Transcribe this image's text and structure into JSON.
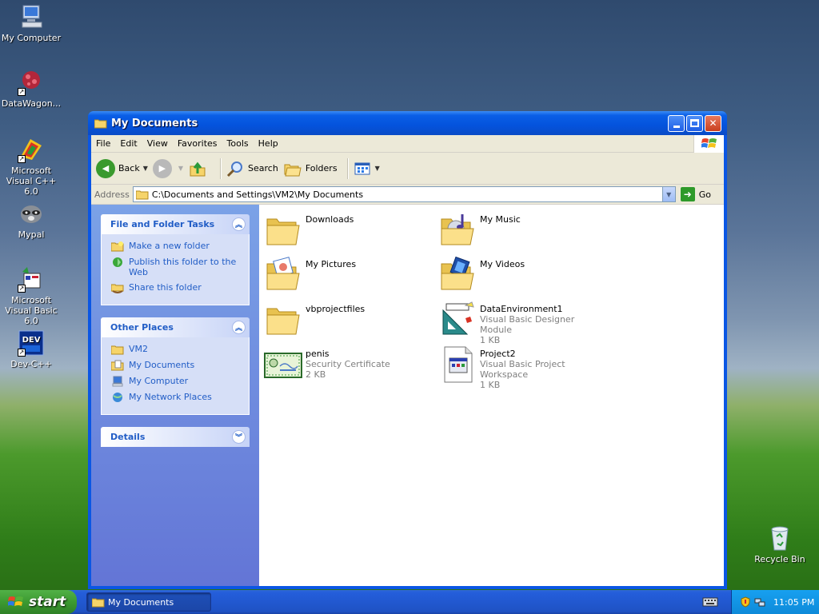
{
  "desktop": {
    "icons": [
      {
        "label": "My Computer"
      },
      {
        "label": "DataWagon..."
      },
      {
        "label": "Microsoft Visual C++ 6.0"
      },
      {
        "label": "Mypal"
      },
      {
        "label": "Microsoft Visual Basic 6.0"
      },
      {
        "label": "Dev-C++"
      },
      {
        "label": "Recycle Bin"
      }
    ]
  },
  "window": {
    "title": "My Documents",
    "menu": [
      "File",
      "Edit",
      "View",
      "Favorites",
      "Tools",
      "Help"
    ],
    "toolbar": {
      "back": "Back",
      "search": "Search",
      "folders": "Folders"
    },
    "address": {
      "label": "Address",
      "value": "C:\\Documents and Settings\\VM2\\My Documents",
      "go": "Go"
    },
    "taskpane": {
      "file_tasks": {
        "title": "File and Folder Tasks",
        "items": [
          "Make a new folder",
          "Publish this folder to the Web",
          "Share this folder"
        ]
      },
      "other_places": {
        "title": "Other Places",
        "items": [
          "VM2",
          "My Documents",
          "My Computer",
          "My Network Places"
        ]
      },
      "details": {
        "title": "Details"
      }
    },
    "files": [
      {
        "name": "Downloads",
        "type": "",
        "size": "",
        "icon": "folder-icon"
      },
      {
        "name": "My Music",
        "type": "",
        "size": "",
        "icon": "music-folder-icon"
      },
      {
        "name": "My Pictures",
        "type": "",
        "size": "",
        "icon": "pictures-folder-icon"
      },
      {
        "name": "My Videos",
        "type": "",
        "size": "",
        "icon": "videos-folder-icon"
      },
      {
        "name": "vbprojectfiles",
        "type": "",
        "size": "",
        "icon": "folder-icon"
      },
      {
        "name": "DataEnvironment1",
        "type": "Visual Basic Designer Module",
        "size": "1 KB",
        "icon": "vb-designer-icon"
      },
      {
        "name": "penis",
        "type": "Security Certificate",
        "size": "2 KB",
        "icon": "certificate-icon"
      },
      {
        "name": "Project2",
        "type": "Visual Basic Project Workspace",
        "size": "1 KB",
        "icon": "vb-project-icon"
      }
    ]
  },
  "taskbar": {
    "start": "start",
    "item": "My Documents",
    "clock": "11:05 PM"
  }
}
